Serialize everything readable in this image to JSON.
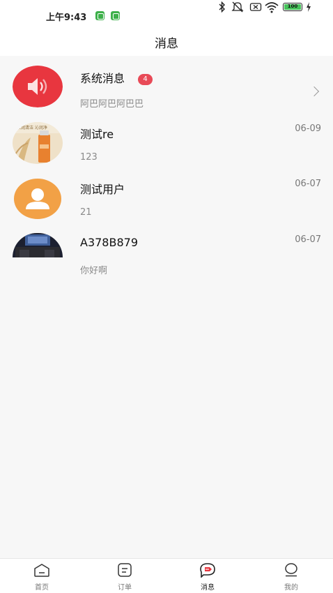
{
  "status_bar": {
    "time": "上午9:43",
    "battery": "100"
  },
  "header": {
    "title": "消息"
  },
  "messages": [
    {
      "name": "系统消息",
      "badge": "4",
      "preview": "阿巴阿巴阿巴巴",
      "date": ""
    },
    {
      "name": "测试re",
      "preview": "123",
      "date": "06-09"
    },
    {
      "name": "测试用户",
      "preview": "21",
      "date": "06-07"
    },
    {
      "name": "A378B879",
      "preview": "你好啊",
      "date": "06-07"
    }
  ],
  "avatar_thumb_text": "泉润清洁 沁润净",
  "nav": [
    {
      "label": "首页",
      "icon": "home-icon"
    },
    {
      "label": "订单",
      "icon": "order-icon"
    },
    {
      "label": "消息",
      "icon": "message-icon"
    },
    {
      "label": "我的",
      "icon": "profile-icon"
    }
  ],
  "colors": {
    "accent": "#e8363f",
    "badge": "#e84a57",
    "avatar_orange": "#f2a146",
    "background": "#f7f7f7"
  }
}
